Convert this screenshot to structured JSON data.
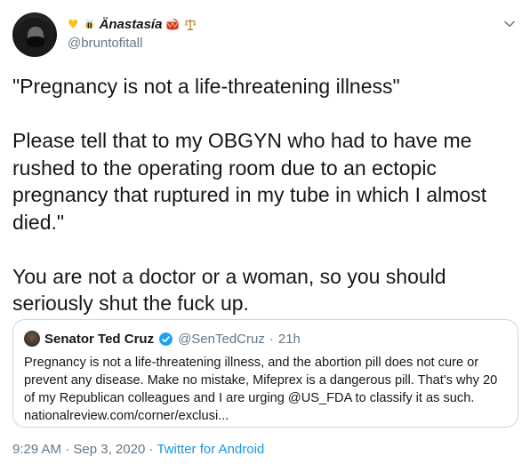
{
  "author": {
    "display_name": "Änastasía",
    "handle": "@bruntofitall",
    "emoji_before": [
      "yellow-heart",
      "bee"
    ],
    "emoji_after": [
      "drum",
      "scales"
    ]
  },
  "tweet": {
    "text": "\"Pregnancy is not a life-threatening illness\"\n\nPlease tell that to my OBGYN who had to have me rushed to the operating room due to an ectopic pregnancy that ruptured in my tube in which I almost died.\"\n\nYou are not a doctor or a woman, so you should seriously shut the fuck up."
  },
  "quoted": {
    "name": "Senator Ted Cruz",
    "handle": "@SenTedCruz",
    "separator": "·",
    "time": "21h",
    "text": "Pregnancy is not a life-threatening illness, and the abortion pill does not cure or prevent any disease. Make no mistake, Mifeprex is a dangerous pill. That's why 20 of my Republican colleagues and I are urging @US_FDA to classify it as such. nationalreview.com/corner/exclusi..."
  },
  "meta": {
    "time": "9:29 AM",
    "separator1": "·",
    "date": "Sep 3, 2020",
    "separator2": "·",
    "source": "Twitter for Android"
  },
  "colors": {
    "text": "#14171a",
    "secondary": "#657786",
    "link": "#1b95e0",
    "border": "#ccd6dd",
    "verified": "#1da1f2"
  }
}
